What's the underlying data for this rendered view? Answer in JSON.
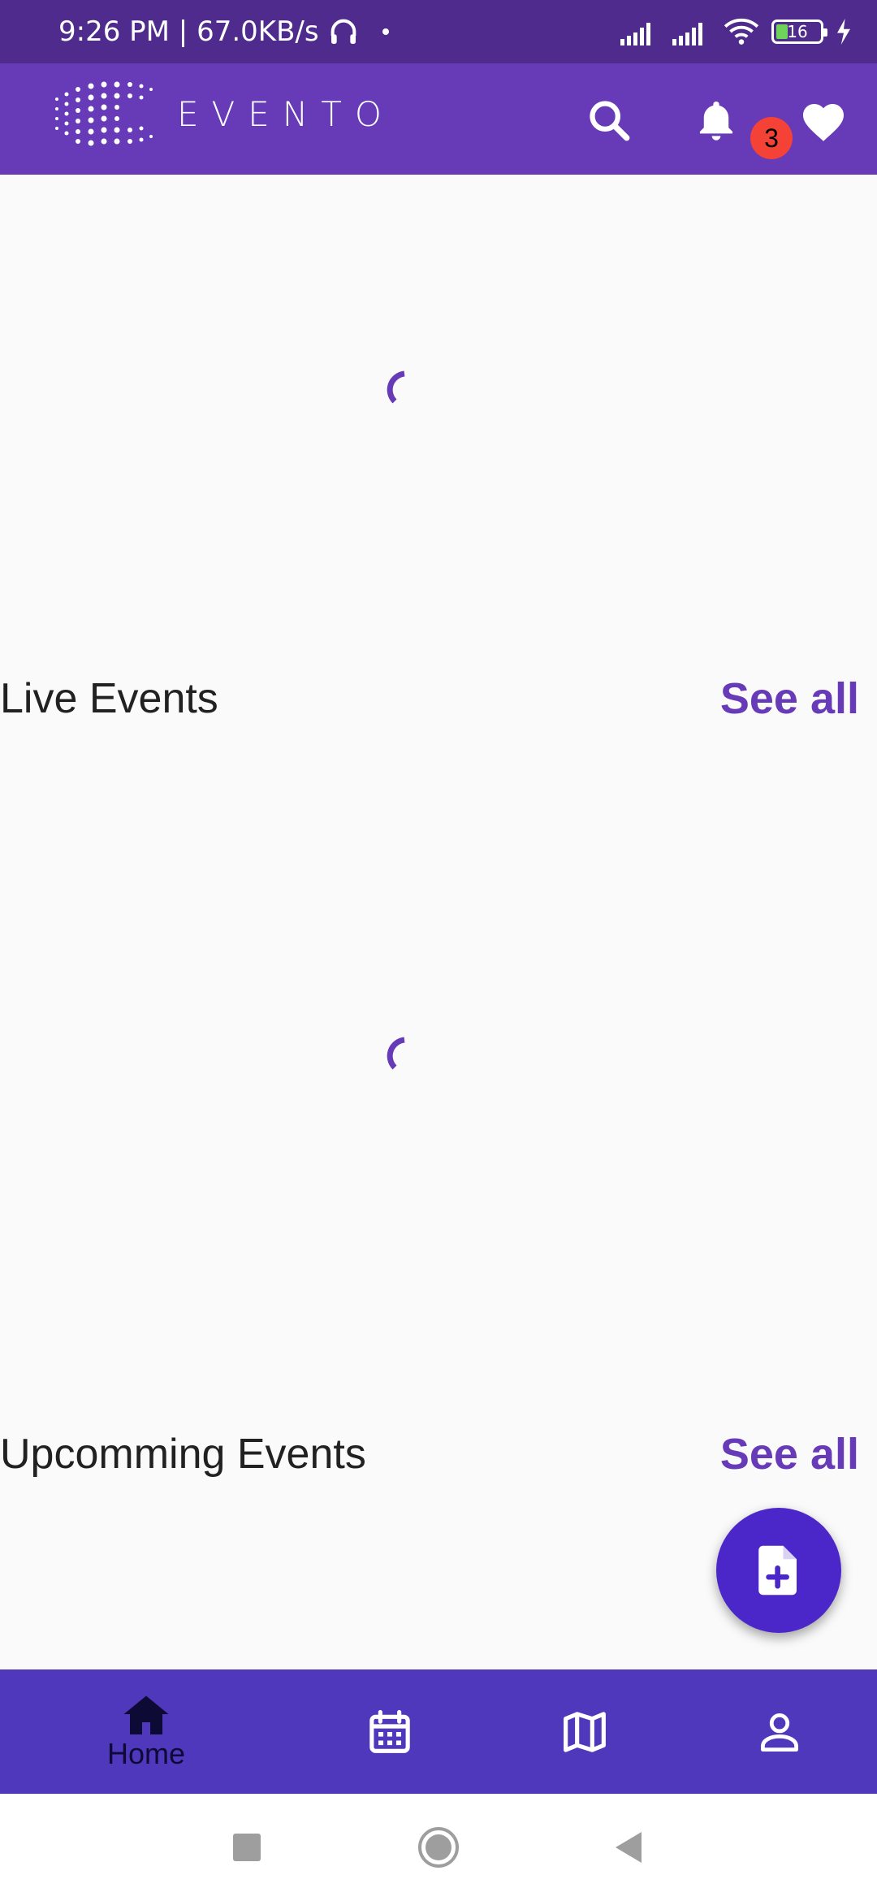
{
  "status_bar": {
    "time_speed": "9:26 PM | 67.0KB/s",
    "battery_level": "16"
  },
  "app_bar": {
    "logo_text": "EVENTO",
    "notification_count": "3",
    "icons": [
      "search-icon",
      "bell-icon",
      "heart-icon"
    ]
  },
  "sections": {
    "live": {
      "title": "Live Events",
      "see_all": "See all"
    },
    "upcoming": {
      "title": "Upcomming Events",
      "see_all": "See all"
    }
  },
  "fab": {
    "icon": "add-document-icon"
  },
  "bottom_nav": {
    "items": [
      {
        "label": "Home",
        "icon": "home-icon"
      },
      {
        "icon": "calendar-icon"
      },
      {
        "icon": "map-icon"
      },
      {
        "icon": "profile-icon"
      }
    ]
  },
  "system_nav": {
    "icons": [
      "recents-icon",
      "home-circle-icon",
      "back-icon"
    ]
  },
  "colors": {
    "status_bar": "#4e2b8c",
    "app_bar": "#673ab7",
    "accent": "#673ab7",
    "fab": "#4b27c9",
    "bottom_nav": "#5038bd",
    "badge": "#f44336"
  }
}
